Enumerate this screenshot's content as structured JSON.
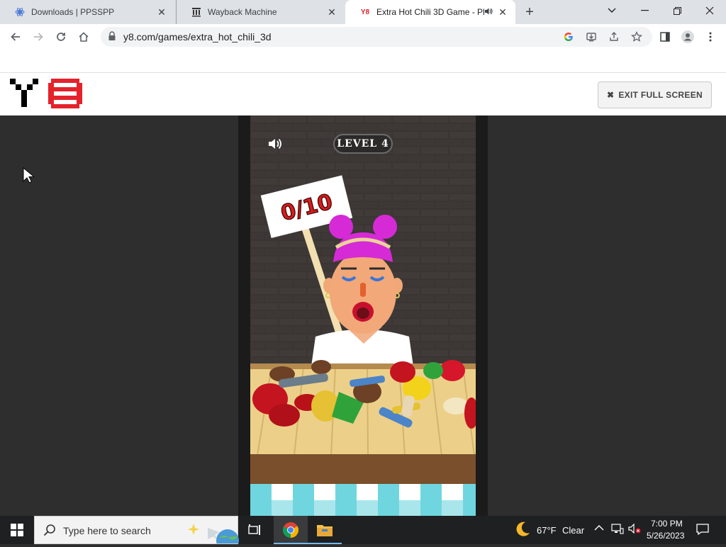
{
  "browser": {
    "tabs": [
      {
        "title": "Downloads | PPSSPP",
        "favicon": "ppsspp-favicon"
      },
      {
        "title": "Wayback Machine",
        "favicon": "archive-favicon"
      },
      {
        "title": "Extra Hot Chili 3D Game - Pl",
        "favicon": "y8-favicon",
        "favicon_text": "Y8",
        "active": true,
        "audio": true
      }
    ],
    "url": "y8.com/games/extra_hot_chili_3d"
  },
  "site": {
    "exit_label": "EXIT FULL SCREEN",
    "logo_colors": {
      "black": "#000000",
      "red": "#e4222b"
    }
  },
  "game": {
    "level_label": "LEVEL 4",
    "sign_text": "0/10"
  },
  "taskbar": {
    "search_placeholder": "Type here to search",
    "weather_temp": "67°F",
    "weather_cond": "Clear",
    "time": "7:00 PM",
    "date": "5/26/2023"
  }
}
